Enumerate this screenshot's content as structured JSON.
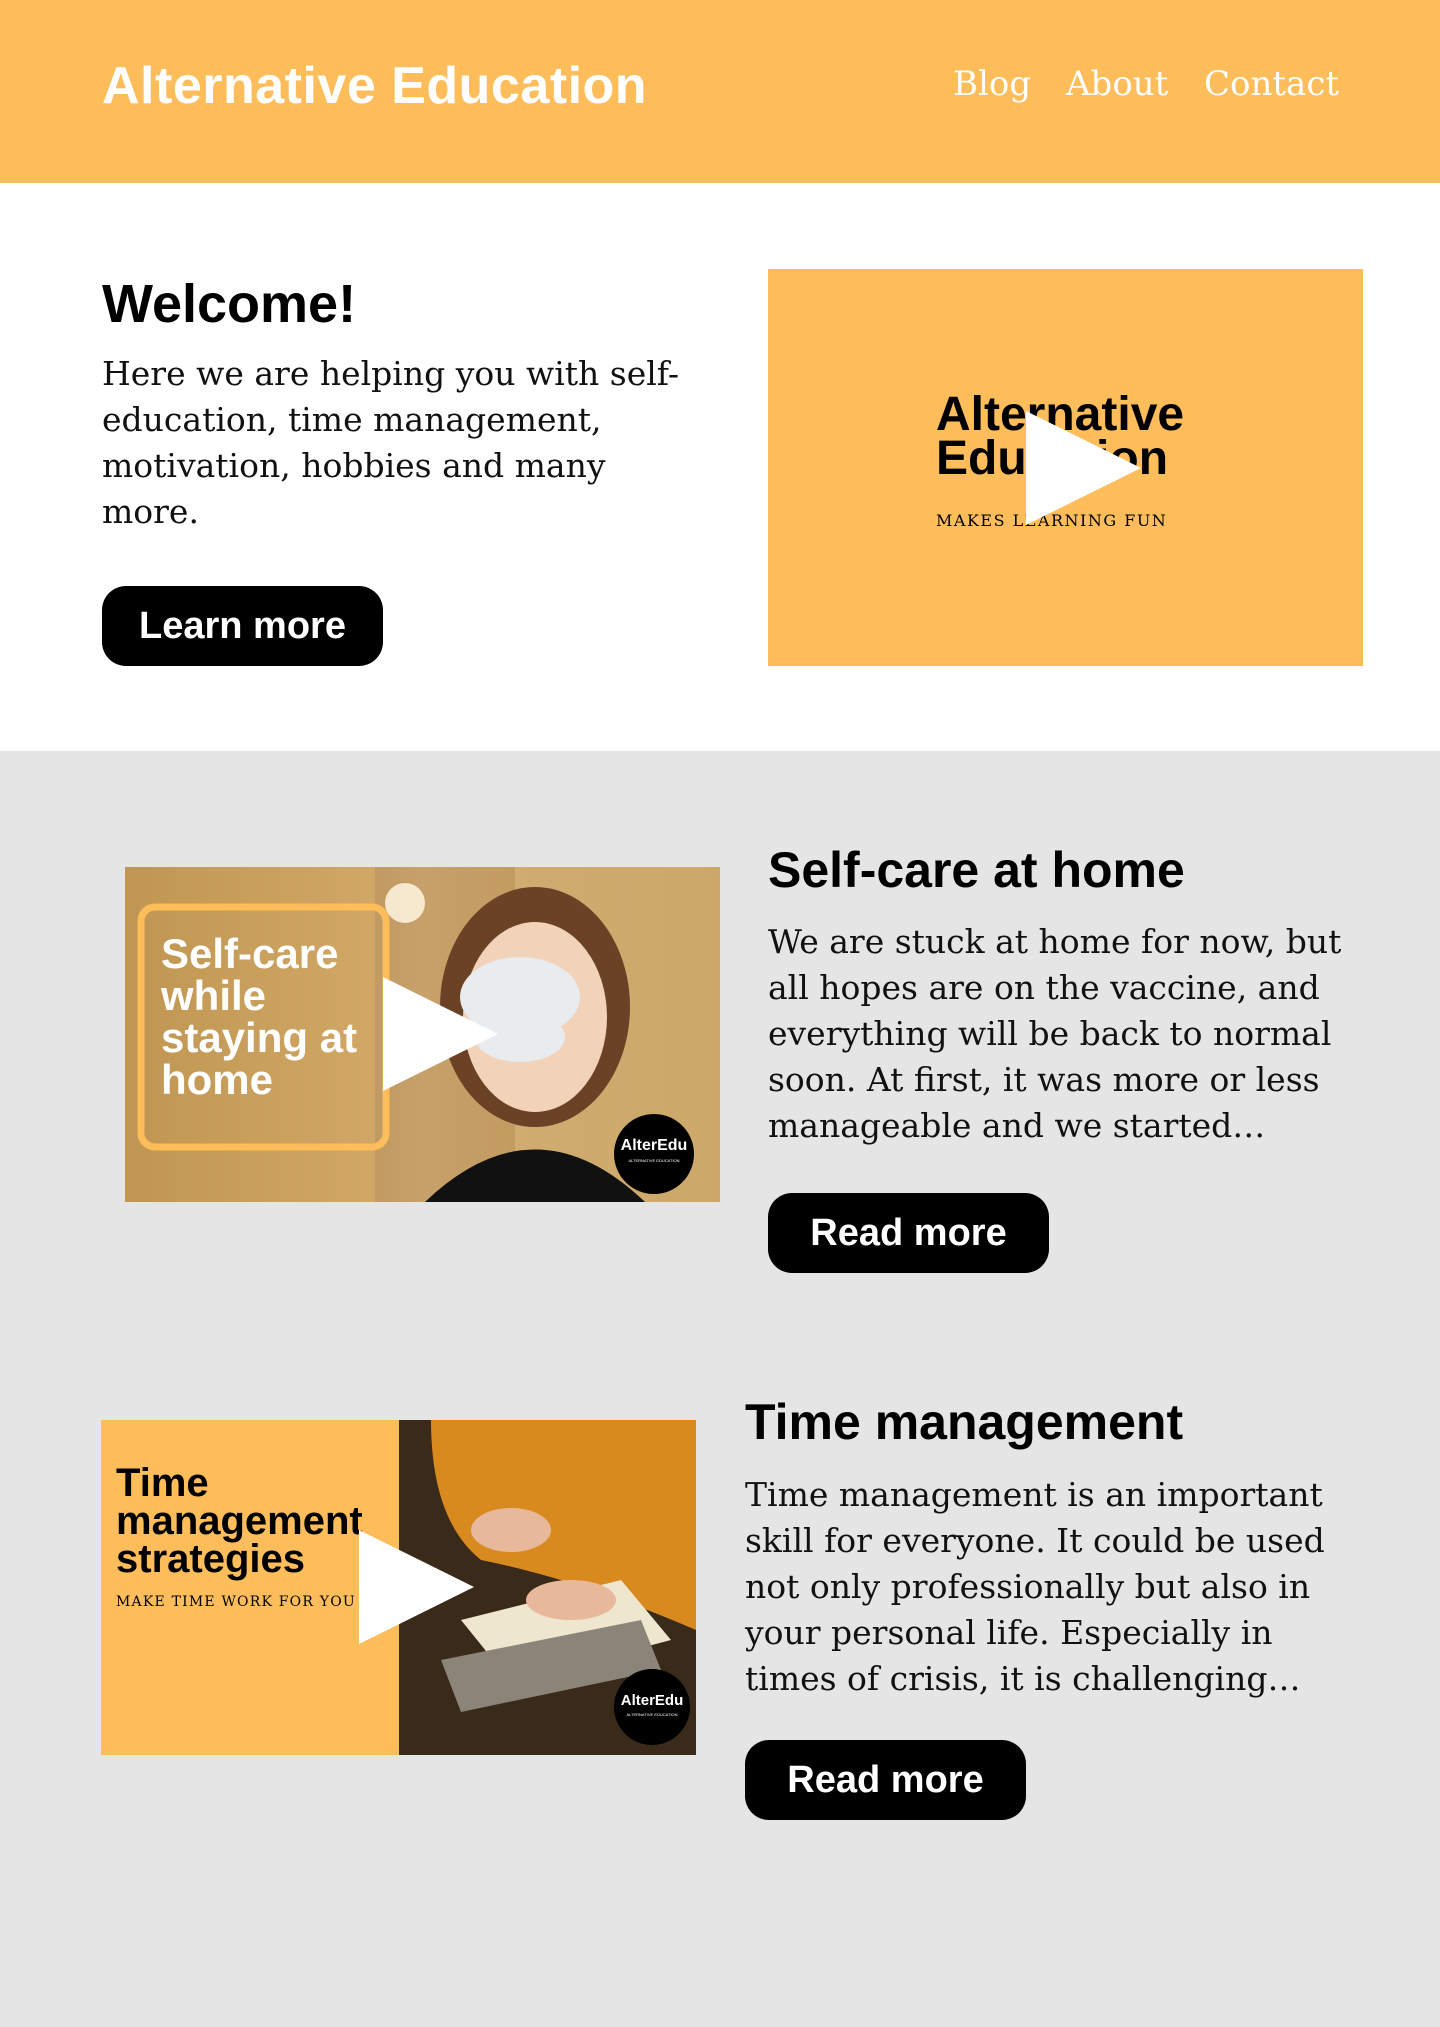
{
  "header": {
    "brand": "Alternative Education",
    "nav": [
      "Blog",
      "About",
      "Contact"
    ]
  },
  "hero": {
    "title": "Welcome!",
    "body": "Here we are helping you with self-education, time management, motivation, hobbies and many more.",
    "button": "Learn more",
    "video": {
      "title_line1": "Alternative",
      "title_line2": "Education",
      "tagline": "MAKES LEARNING FUN"
    }
  },
  "posts": [
    {
      "title": "Self-care at home",
      "body": "We are stuck at home for now, but all hopes are on the vaccine, and everything will be back to normal soon. At first, it was more or less manageable and we started…",
      "button": "Read more",
      "thumb_text": [
        "Self-care",
        "while",
        "staying at",
        "home"
      ],
      "badge": "AlterEdu",
      "badge_sub": "ALTERNATIVE EDUCATION"
    },
    {
      "title": "Time management",
      "body": "Time management is an important skill for everyone. It could be used not only professionally but also in your personal life. Especially in times of crisis, it is challenging…",
      "button": "Read more",
      "thumb_text": [
        "Time",
        "management",
        "strategies"
      ],
      "thumb_tagline": "MAKE TIME WORK FOR YOU",
      "badge": "AlterEdu",
      "badge_sub": "ALTERNATIVE EDUCATION"
    }
  ],
  "colors": {
    "accent": "#fdbd5a",
    "section_bg": "#e5e5e5",
    "button_bg": "#000000"
  }
}
